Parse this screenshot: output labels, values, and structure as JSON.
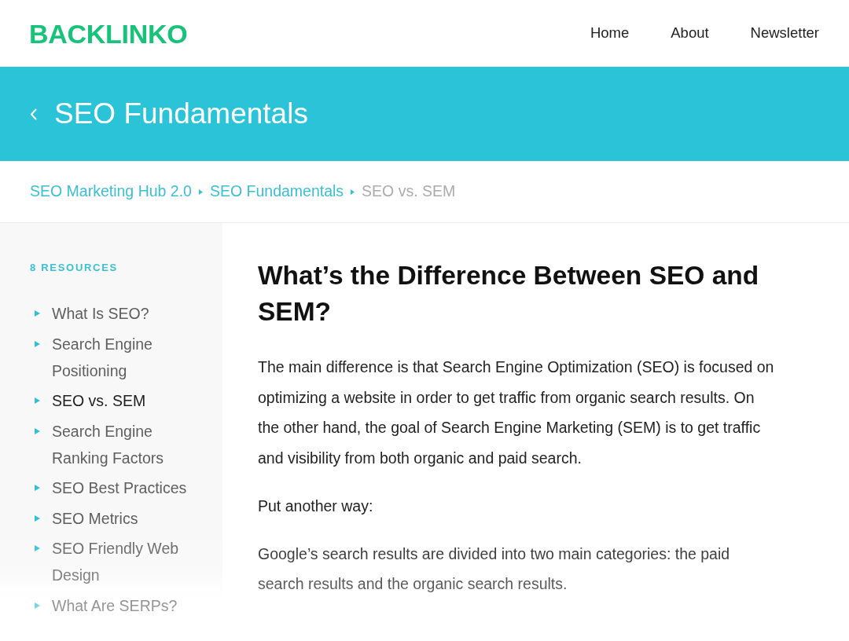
{
  "header": {
    "logo": "BACKLINKO",
    "nav": [
      "Home",
      "About",
      "Newsletter"
    ]
  },
  "banner": {
    "title": "SEO Fundamentals"
  },
  "breadcrumb": [
    {
      "label": "SEO Marketing Hub 2.0",
      "kind": "link"
    },
    {
      "label": "SEO Fundamentals",
      "kind": "link"
    },
    {
      "label": "SEO vs. SEM",
      "kind": "current"
    }
  ],
  "sidebar": {
    "heading": "8 RESOURCES",
    "items": [
      {
        "label": "What Is SEO?",
        "selected": false
      },
      {
        "label": "Search Engine Positioning",
        "selected": false
      },
      {
        "label": "SEO vs. SEM",
        "selected": true
      },
      {
        "label": "Search Engine Ranking Factors",
        "selected": false
      },
      {
        "label": "SEO Best Practices",
        "selected": false
      },
      {
        "label": "SEO Metrics",
        "selected": false
      },
      {
        "label": "SEO Friendly Web Design",
        "selected": false
      },
      {
        "label": "What Are SERPs?",
        "selected": false
      }
    ]
  },
  "article": {
    "title": "What’s the Difference Between SEO and SEM?",
    "paragraphs": [
      "The main difference is that Search Engine Optimization (SEO) is focused on optimizing a website in order to get traffic from organic search results. On the other hand, the goal of Search Engine Marketing (SEM) is to get traffic and visibility from both organic and paid search.",
      "Put another way:",
      "Google’s search results are divided into two main categories: the paid search results and the organic search results."
    ]
  }
}
